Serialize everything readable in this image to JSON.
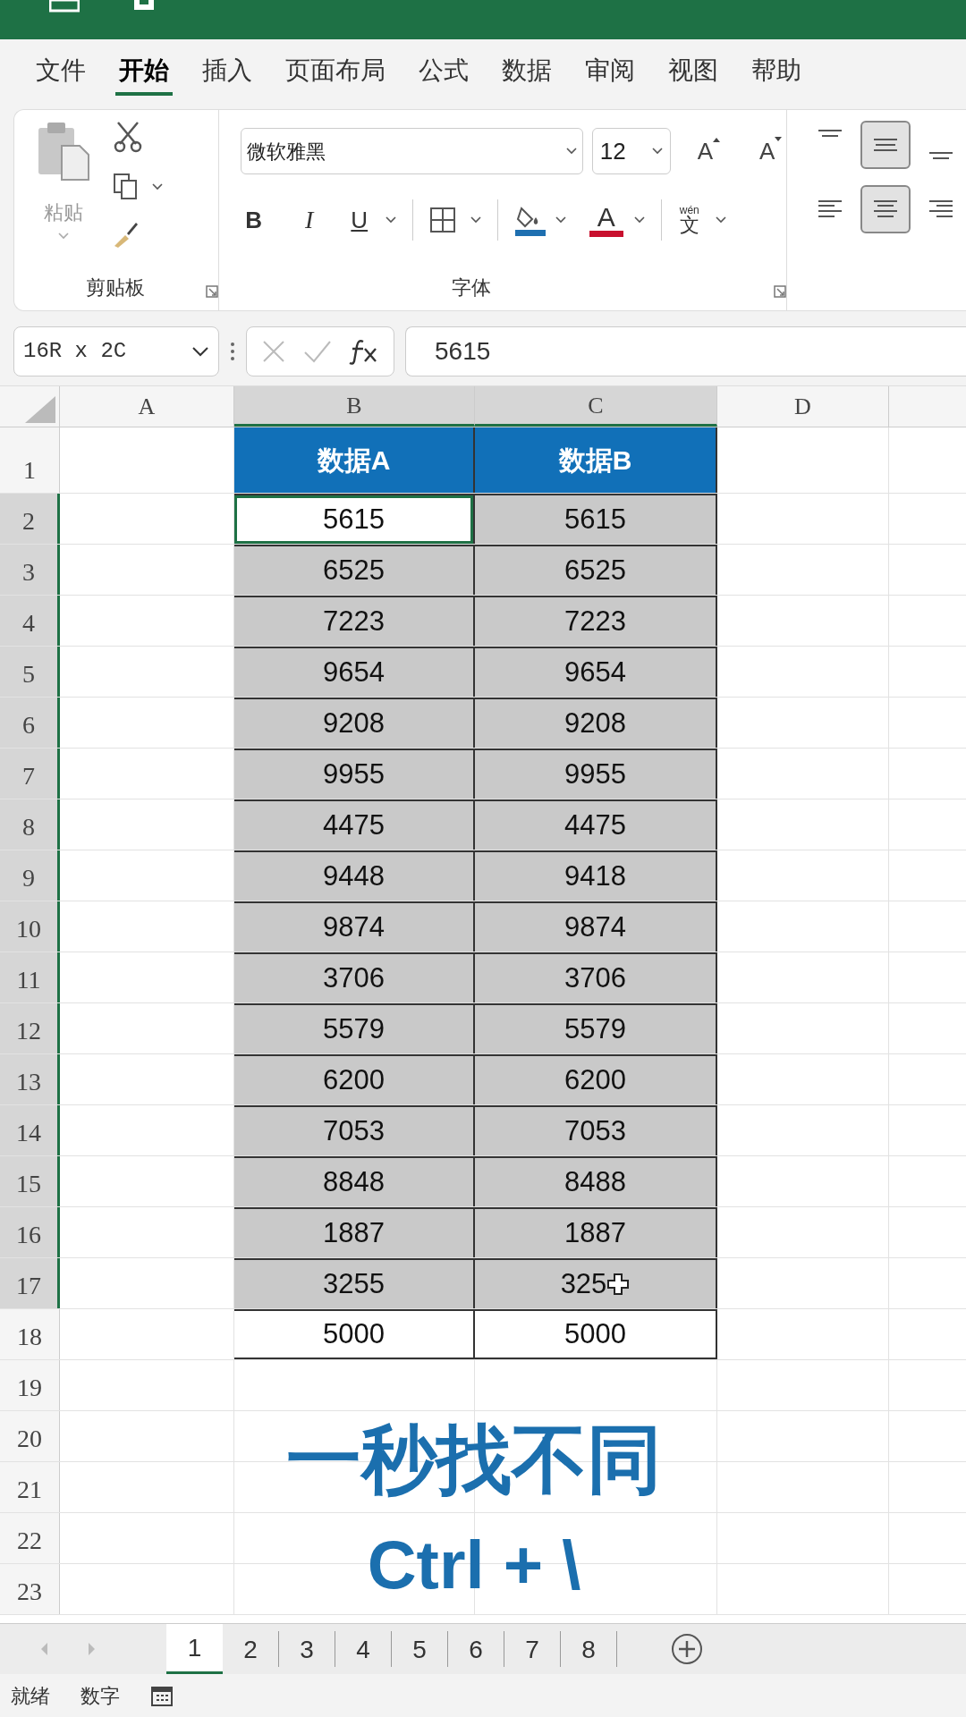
{
  "menu_tabs": [
    {
      "label": "文件",
      "selected": false
    },
    {
      "label": "开始",
      "selected": true
    },
    {
      "label": "插入",
      "selected": false
    },
    {
      "label": "页面布局",
      "selected": false
    },
    {
      "label": "公式",
      "selected": false
    },
    {
      "label": "数据",
      "selected": false
    },
    {
      "label": "审阅",
      "selected": false
    },
    {
      "label": "视图",
      "selected": false
    },
    {
      "label": "帮助",
      "selected": false
    }
  ],
  "ribbon": {
    "clipboard": {
      "paste_label": "粘贴",
      "group_label": "剪贴板"
    },
    "font": {
      "font_name": "微软雅黑",
      "font_size": "12",
      "grow_label": "A",
      "shrink_label": "A",
      "bold_label": "B",
      "italic_label": "I",
      "underline_label": "U",
      "font_color_label": "A",
      "phonetic_top": "wén",
      "phonetic_bottom": "文",
      "group_label": "字体"
    },
    "vertical_alignment": [
      {
        "selected": false
      },
      {
        "selected": true
      },
      {
        "selected": false
      }
    ],
    "horizontal_alignment": [
      {
        "selected": false
      },
      {
        "selected": true
      },
      {
        "selected": false
      }
    ]
  },
  "name_box": "16R x 2C",
  "formula": "5615",
  "columns": [
    {
      "label": "A",
      "selected": false
    },
    {
      "label": "B",
      "selected": true
    },
    {
      "label": "C",
      "selected": true
    },
    {
      "label": "D",
      "selected": false
    }
  ],
  "rows": [
    {
      "number": "1",
      "selected": false,
      "kind": "header",
      "cells": [
        {
          "text": "数据A"
        },
        {
          "text": "数据B"
        }
      ]
    },
    {
      "number": "2",
      "selected": true,
      "kind": "data",
      "cells": [
        {
          "text": "5615",
          "active": true
        },
        {
          "text": "5615",
          "active": false
        }
      ]
    },
    {
      "number": "3",
      "selected": true,
      "kind": "data",
      "cells": [
        {
          "text": "6525",
          "active": false
        },
        {
          "text": "6525",
          "active": false
        }
      ]
    },
    {
      "number": "4",
      "selected": true,
      "kind": "data",
      "cells": [
        {
          "text": "7223",
          "active": false
        },
        {
          "text": "7223",
          "active": false
        }
      ]
    },
    {
      "number": "5",
      "selected": true,
      "kind": "data",
      "cells": [
        {
          "text": "9654",
          "active": false
        },
        {
          "text": "9654",
          "active": false
        }
      ]
    },
    {
      "number": "6",
      "selected": true,
      "kind": "data",
      "cells": [
        {
          "text": "9208",
          "active": false
        },
        {
          "text": "9208",
          "active": false
        }
      ]
    },
    {
      "number": "7",
      "selected": true,
      "kind": "data",
      "cells": [
        {
          "text": "9955",
          "active": false
        },
        {
          "text": "9955",
          "active": false
        }
      ]
    },
    {
      "number": "8",
      "selected": true,
      "kind": "data",
      "cells": [
        {
          "text": "4475",
          "active": false
        },
        {
          "text": "4475",
          "active": false
        }
      ]
    },
    {
      "number": "9",
      "selected": true,
      "kind": "data",
      "cells": [
        {
          "text": "9448",
          "active": false
        },
        {
          "text": "9418",
          "active": false
        }
      ]
    },
    {
      "number": "10",
      "selected": true,
      "kind": "data",
      "cells": [
        {
          "text": "9874",
          "active": false
        },
        {
          "text": "9874",
          "active": false
        }
      ]
    },
    {
      "number": "11",
      "selected": true,
      "kind": "data",
      "cells": [
        {
          "text": "3706",
          "active": false
        },
        {
          "text": "3706",
          "active": false
        }
      ]
    },
    {
      "number": "12",
      "selected": true,
      "kind": "data",
      "cells": [
        {
          "text": "5579",
          "active": false
        },
        {
          "text": "5579",
          "active": false
        }
      ]
    },
    {
      "number": "13",
      "selected": true,
      "kind": "data",
      "cells": [
        {
          "text": "6200",
          "active": false
        },
        {
          "text": "6200",
          "active": false
        }
      ]
    },
    {
      "number": "14",
      "selected": true,
      "kind": "data",
      "cells": [
        {
          "text": "7053",
          "active": false
        },
        {
          "text": "7053",
          "active": false
        }
      ]
    },
    {
      "number": "15",
      "selected": true,
      "kind": "data",
      "cells": [
        {
          "text": "8848",
          "active": false
        },
        {
          "text": "8488",
          "active": false
        }
      ]
    },
    {
      "number": "16",
      "selected": true,
      "kind": "data",
      "cells": [
        {
          "text": "1887",
          "active": false
        },
        {
          "text": "1887",
          "active": false
        }
      ]
    },
    {
      "number": "17",
      "selected": true,
      "kind": "data",
      "cells": [
        {
          "text": "3255",
          "active": false
        },
        {
          "text": "325",
          "active": false
        }
      ]
    },
    {
      "number": "18",
      "selected": false,
      "kind": "data",
      "cells": [
        {
          "text": "5000",
          "active": false
        },
        {
          "text": "5000",
          "active": false
        }
      ]
    },
    {
      "number": "19",
      "selected": false,
      "kind": "empty"
    },
    {
      "number": "20",
      "selected": false,
      "kind": "empty"
    },
    {
      "number": "21",
      "selected": false,
      "kind": "empty"
    },
    {
      "number": "22",
      "selected": false,
      "kind": "empty"
    },
    {
      "number": "23",
      "selected": false,
      "kind": "empty"
    }
  ],
  "caption": [
    "一秒找不同",
    "Ctrl + \\"
  ],
  "sheet_tabs": [
    {
      "label": "1",
      "selected": true
    },
    {
      "label": "2",
      "selected": false
    },
    {
      "label": "3",
      "selected": false
    },
    {
      "label": "4",
      "selected": false
    },
    {
      "label": "5",
      "selected": false
    },
    {
      "label": "6",
      "selected": false
    },
    {
      "label": "7",
      "selected": false
    },
    {
      "label": "8",
      "selected": false
    }
  ],
  "status_bar": [
    "就绪",
    "数字"
  ]
}
